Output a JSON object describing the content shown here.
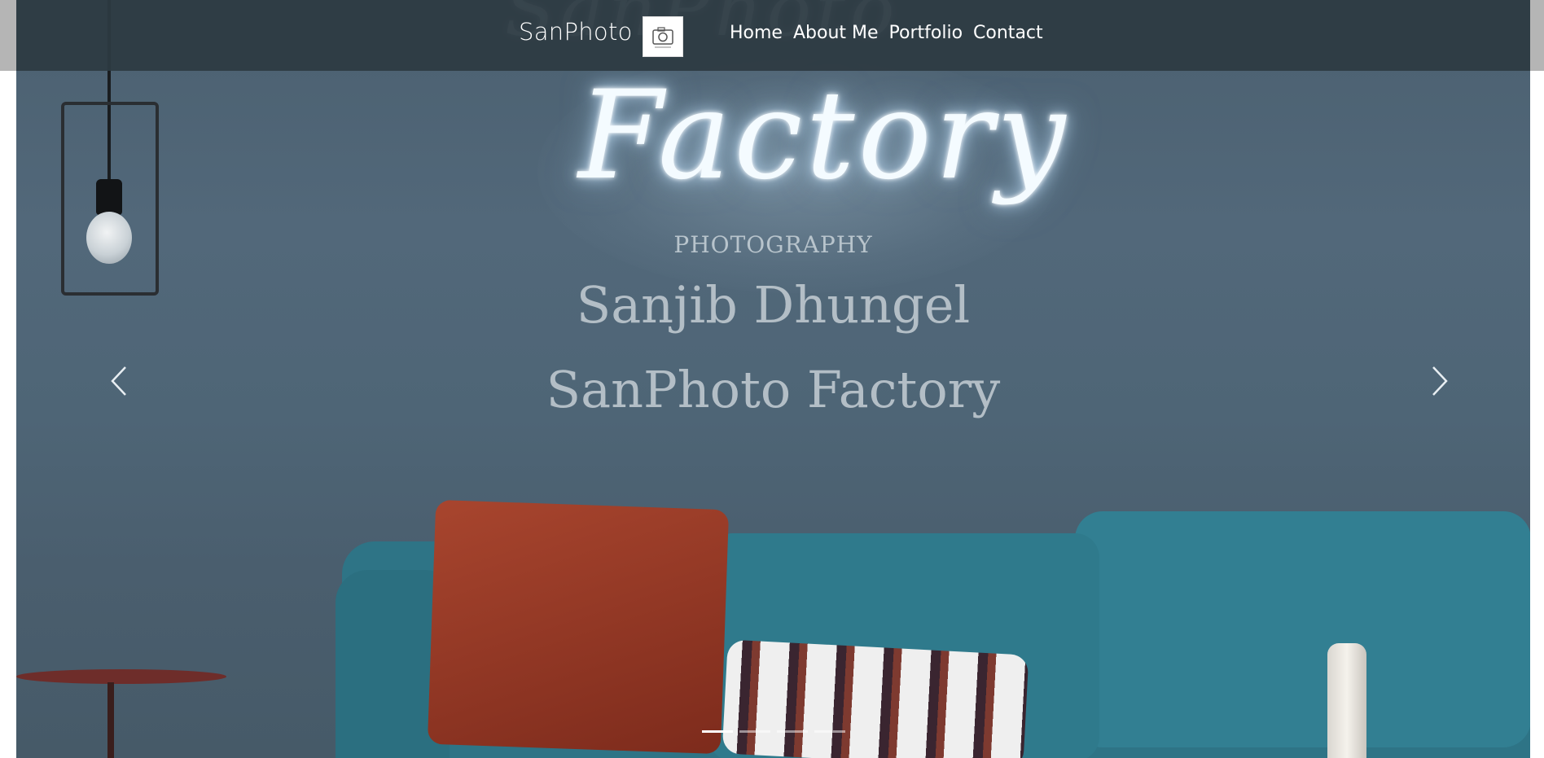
{
  "navbar": {
    "brand": "SanPhoto",
    "logo_icon": "camera-icon",
    "links": [
      {
        "label": "Home"
      },
      {
        "label": "About Me"
      },
      {
        "label": "Portfolio"
      },
      {
        "label": "Contact"
      }
    ]
  },
  "hero": {
    "neon_text": "Factory",
    "subtitle": "PHOTOGRAPHY",
    "name": "Sanjib Dhungel",
    "studio": "SanPhoto Factory",
    "prev_icon": "chevron-left-icon",
    "next_icon": "chevron-right-icon",
    "indicators": {
      "count": 4,
      "active": 0
    }
  }
}
